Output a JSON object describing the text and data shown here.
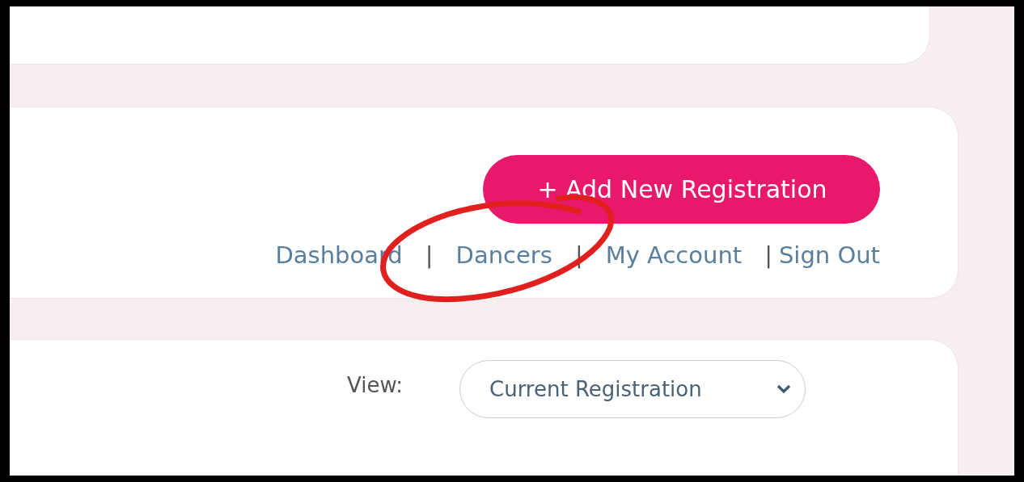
{
  "actions": {
    "add_button": "+ Add New Registration",
    "nav": [
      {
        "kind": "link",
        "label": "Dashboard"
      },
      {
        "kind": "separator",
        "label": "|"
      },
      {
        "kind": "link",
        "label": "Dancers"
      },
      {
        "kind": "separator",
        "label": "|"
      },
      {
        "kind": "link",
        "label": "My Account"
      },
      {
        "kind": "separator",
        "label": "|"
      },
      {
        "kind": "link",
        "label": "Sign Out"
      }
    ]
  },
  "view_filter": {
    "label": "View:",
    "value": "Current Registration"
  },
  "annotations": [
    {
      "kind": "circle",
      "color": "#e0201f"
    }
  ]
}
